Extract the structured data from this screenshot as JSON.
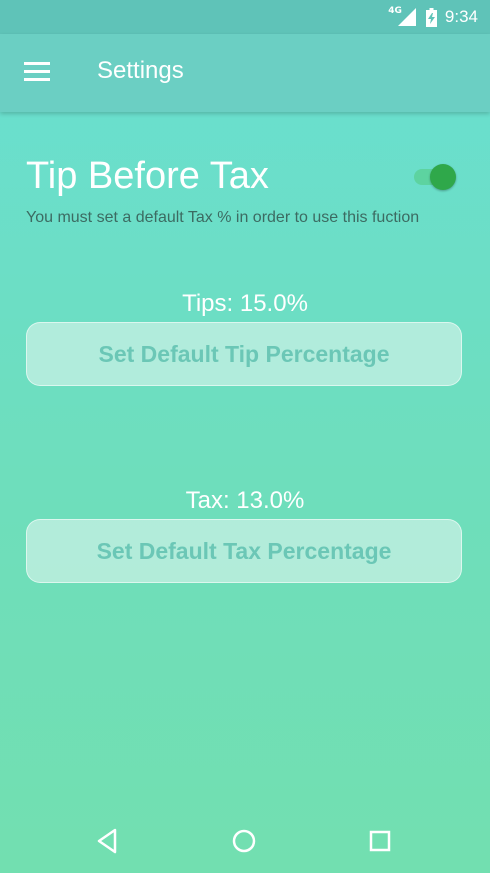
{
  "status_bar": {
    "network_label": "4G",
    "time": "9:34",
    "icons": [
      "signal-icon",
      "battery-charging-icon"
    ]
  },
  "app_bar": {
    "title": "Settings",
    "menu_icon": "menu-icon"
  },
  "tip_before_tax": {
    "title": "Tip Before Tax",
    "toggle_on": true,
    "helper_text": "You must set a default Tax % in order to use this fuction"
  },
  "tips": {
    "label": "Tips: 15.0%",
    "button_label": "Set Default Tip Percentage"
  },
  "tax": {
    "label": "Tax: 13.0%",
    "button_label": "Set Default Tax Percentage"
  },
  "nav_bar": {
    "icons": [
      "back-icon",
      "home-icon",
      "recents-icon"
    ]
  },
  "colors": {
    "status_bar": "#5fc3b8",
    "app_bar": "#6bcfc3",
    "toggle_thumb": "#2fa84a",
    "button_text": "#6bc7b6"
  }
}
